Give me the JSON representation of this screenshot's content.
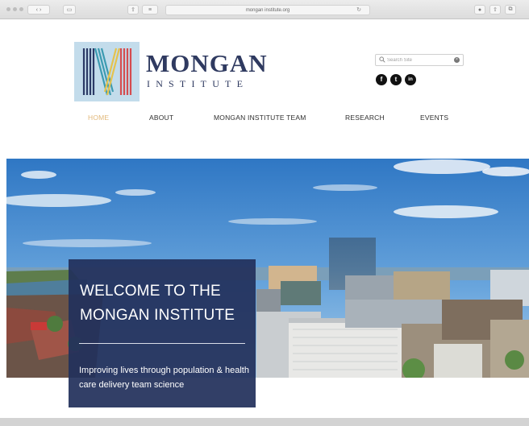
{
  "browser": {
    "url": "mongan institute.org",
    "tab_icons": [
      "back-icon",
      "forward-icon",
      "sidebar-icon",
      "share-icon",
      "reader-icon",
      "reload-icon"
    ]
  },
  "header": {
    "brand_name": "MONGAN",
    "brand_sub": "INSTITUTE",
    "search": {
      "placeholder": "Search Site",
      "value": ""
    },
    "social": [
      {
        "name": "facebook-icon",
        "glyph": "f"
      },
      {
        "name": "twitter-icon",
        "glyph": "t"
      },
      {
        "name": "linkedin-icon",
        "glyph": "in"
      }
    ]
  },
  "nav": {
    "items": [
      {
        "label": "HOME",
        "active": true
      },
      {
        "label": "ABOUT",
        "active": false
      },
      {
        "label": "MONGAN INSTITUTE TEAM",
        "active": false
      },
      {
        "label": "RESEARCH",
        "active": false
      },
      {
        "label": "EVENTS",
        "active": false
      }
    ]
  },
  "hero": {
    "title": "WELCOME TO THE MONGAN INSTITUTE",
    "subtitle": "Improving lives through population & health care delivery team science"
  },
  "colors": {
    "navy": "#22305b",
    "active_nav": "#e2b87a",
    "logo_bg": "#c3dceb"
  }
}
